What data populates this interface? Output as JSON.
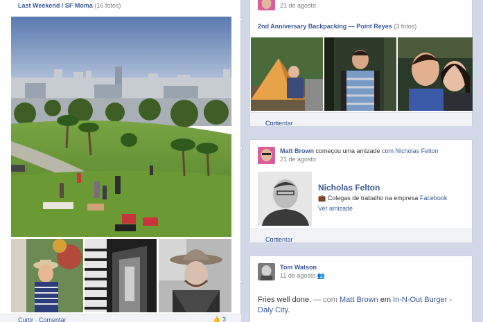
{
  "album": {
    "title": "Last Weekend / SF Moma",
    "count": "(16 fotos)",
    "action_curtir": "Curtir",
    "separator": " · ",
    "action_comentar": "Comentar",
    "likes": "3"
  },
  "top_card": {
    "date": "21 de agosto",
    "album_title": "2nd Anniversary Backpacking — Point Reyes",
    "album_count": "(3 fotos)",
    "action_curtir": "Curtir",
    "separator": " · ",
    "action_comentar": "Comentar"
  },
  "friend_card": {
    "author": "Matt Brown",
    "verb": " começou uma amizade ",
    "with_word": "com",
    "friend": "Nicholas Felton",
    "date": "21 de agosto",
    "friend_title": "Nicholas Felton",
    "work_prefix": "Colegas de trabalho na empresa",
    "company": "Facebook",
    "view_friendship": "Ver amizade",
    "action_curtir": "Curtir",
    "separator": " · ",
    "action_comentar": "Comentar"
  },
  "post_card": {
    "author": "Tom Watson",
    "date": "11 de agosto",
    "text": "Fries well done.",
    "dash": " — com ",
    "tagged": "Matt Brown",
    "at_word": " em ",
    "place": "In-N-Out Burger - Daly City",
    "period": "."
  },
  "colors": {
    "link": "#3b5998",
    "background": "#d3d8e8",
    "card": "#ffffff"
  }
}
